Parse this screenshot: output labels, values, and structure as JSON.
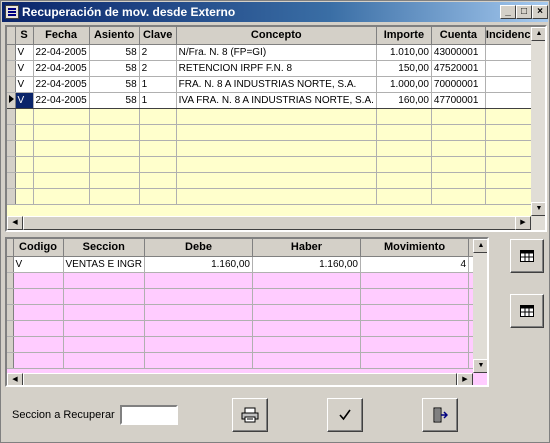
{
  "window": {
    "title": "Recuperación de mov. desde Externo"
  },
  "top_grid": {
    "columns": [
      "S",
      "Fecha",
      "Asiento",
      "Clave",
      "Concepto",
      "Importe",
      "Cuenta",
      "Incidencia"
    ],
    "rows": [
      {
        "s": "V",
        "fecha": "22-04-2005",
        "asiento": "58",
        "clave": "2",
        "concepto": "N/Fra. N. 8 (FP=GI)",
        "importe": "1.010,00",
        "cuenta": "43000001",
        "incidencia": ""
      },
      {
        "s": "V",
        "fecha": "22-04-2005",
        "asiento": "58",
        "clave": "2",
        "concepto": " RETENCION IRPF F.N. 8",
        "importe": "150,00",
        "cuenta": "47520001",
        "incidencia": ""
      },
      {
        "s": "V",
        "fecha": "22-04-2005",
        "asiento": "58",
        "clave": "1",
        "concepto": "FRA. N. 8 A INDUSTRIAS NORTE, S.A.",
        "importe": "1.000,00",
        "cuenta": "70000001",
        "incidencia": ""
      },
      {
        "s": "V",
        "fecha": "22-04-2005",
        "asiento": "58",
        "clave": "1",
        "concepto": "IVA FRA. N. 8 A INDUSTRIAS NORTE, S.A.",
        "importe": "160,00",
        "cuenta": "47700001",
        "incidencia": ""
      }
    ],
    "selected_row": 3
  },
  "bottom_grid": {
    "columns": [
      "Codigo",
      "Seccion",
      "Debe",
      "Haber",
      "Movimiento"
    ],
    "rows": [
      {
        "codigo": "V",
        "seccion": "VENTAS  E INGR",
        "debe": "1.160,00",
        "haber": "1.160,00",
        "movimiento": "4"
      }
    ]
  },
  "footer": {
    "seccion_label": "Seccion a Recuperar",
    "seccion_value": ""
  },
  "icons": {
    "grid_button_1": "table-grid-icon",
    "grid_button_2": "table-grid-icon",
    "print": "printer-icon",
    "accept": "checkmark-icon",
    "exit": "exit-door-icon"
  }
}
